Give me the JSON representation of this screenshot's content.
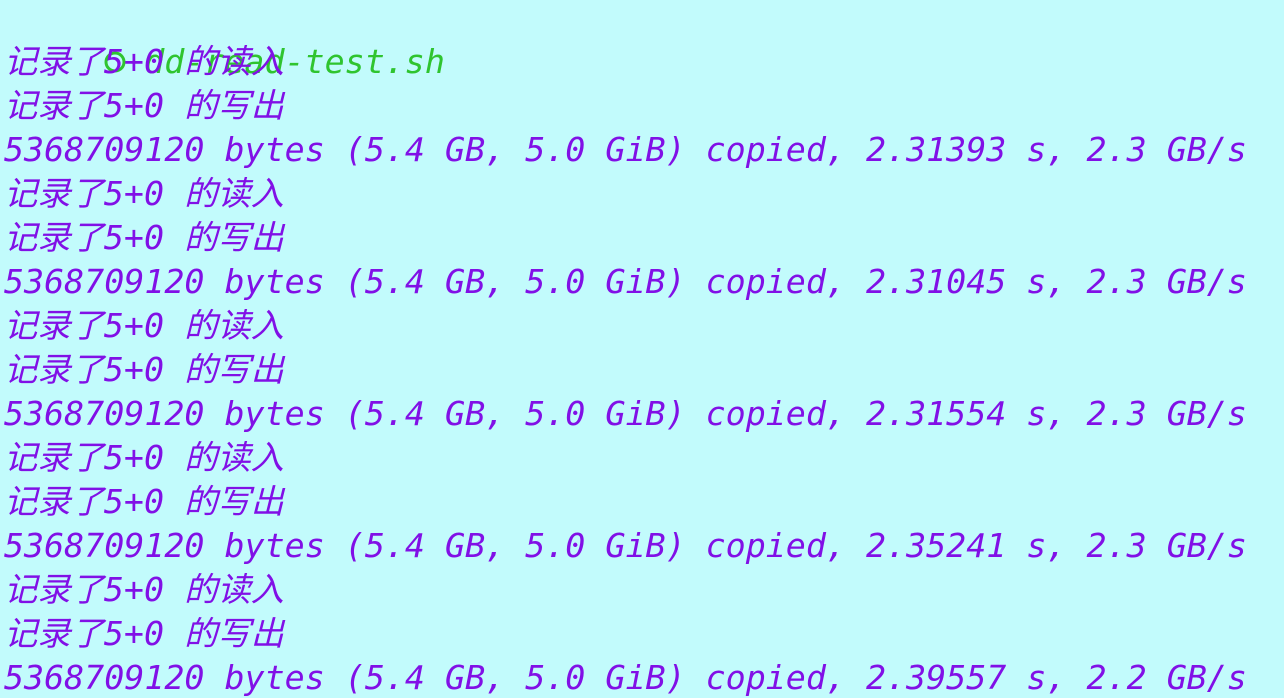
{
  "header": {
    "bullet_icon": "hollow-circle-icon",
    "command": "dd-read-test.sh",
    "color": "#2fc42f"
  },
  "output_color": "#8110e6",
  "background_color": "#c2fbfc",
  "runs": [
    {
      "read_line": "记录了5+0 的读入",
      "write_line": "记录了5+0 的写出",
      "result_line": "5368709120 bytes (5.4 GB, 5.0 GiB) copied, 2.31393 s, 2.3 GB/s"
    },
    {
      "read_line": "记录了5+0 的读入",
      "write_line": "记录了5+0 的写出",
      "result_line": "5368709120 bytes (5.4 GB, 5.0 GiB) copied, 2.31045 s, 2.3 GB/s"
    },
    {
      "read_line": "记录了5+0 的读入",
      "write_line": "记录了5+0 的写出",
      "result_line": "5368709120 bytes (5.4 GB, 5.0 GiB) copied, 2.31554 s, 2.3 GB/s"
    },
    {
      "read_line": "记录了5+0 的读入",
      "write_line": "记录了5+0 的写出",
      "result_line": "5368709120 bytes (5.4 GB, 5.0 GiB) copied, 2.35241 s, 2.3 GB/s"
    },
    {
      "read_line": "记录了5+0 的读入",
      "write_line": "记录了5+0 的写出",
      "result_line": "5368709120 bytes (5.4 GB, 5.0 GiB) copied, 2.39557 s, 2.2 GB/s"
    }
  ]
}
